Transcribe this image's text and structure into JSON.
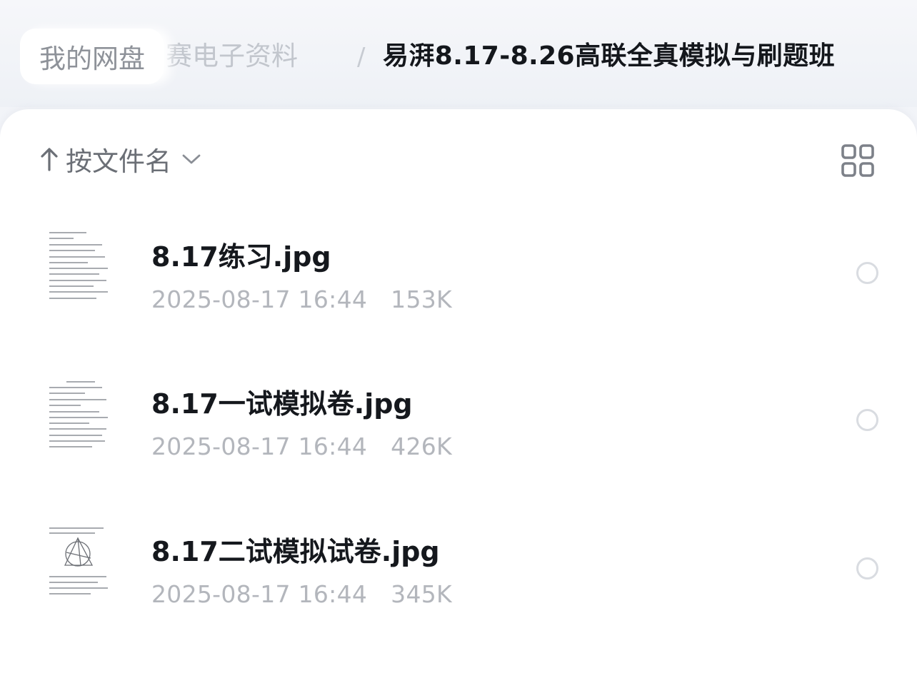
{
  "breadcrumb": {
    "root": "我的网盘",
    "middle": "赛电子资料",
    "separator": "/",
    "current": "易湃8.17-8.26高联全真模拟与刷题班"
  },
  "toolbar": {
    "sort_label": "按文件名",
    "sort_direction_icon": "arrow-up-icon",
    "sort_dropdown_icon": "chevron-down-icon",
    "view_toggle_icon": "grid-view-icon"
  },
  "files": [
    {
      "name": "8.17练习.jpg",
      "date": "2025-08-17 16:44",
      "size": "153K"
    },
    {
      "name": "8.17一试模拟卷.jpg",
      "date": "2025-08-17 16:44",
      "size": "426K"
    },
    {
      "name": "8.17二试模拟试卷.jpg",
      "date": "2025-08-17 16:44",
      "size": "345K"
    }
  ],
  "colors": {
    "background": "#f2f4f8",
    "card": "#ffffff",
    "title_text": "#14171c",
    "secondary_text": "#b3b6bc",
    "icon_gray": "#6b6f76"
  }
}
